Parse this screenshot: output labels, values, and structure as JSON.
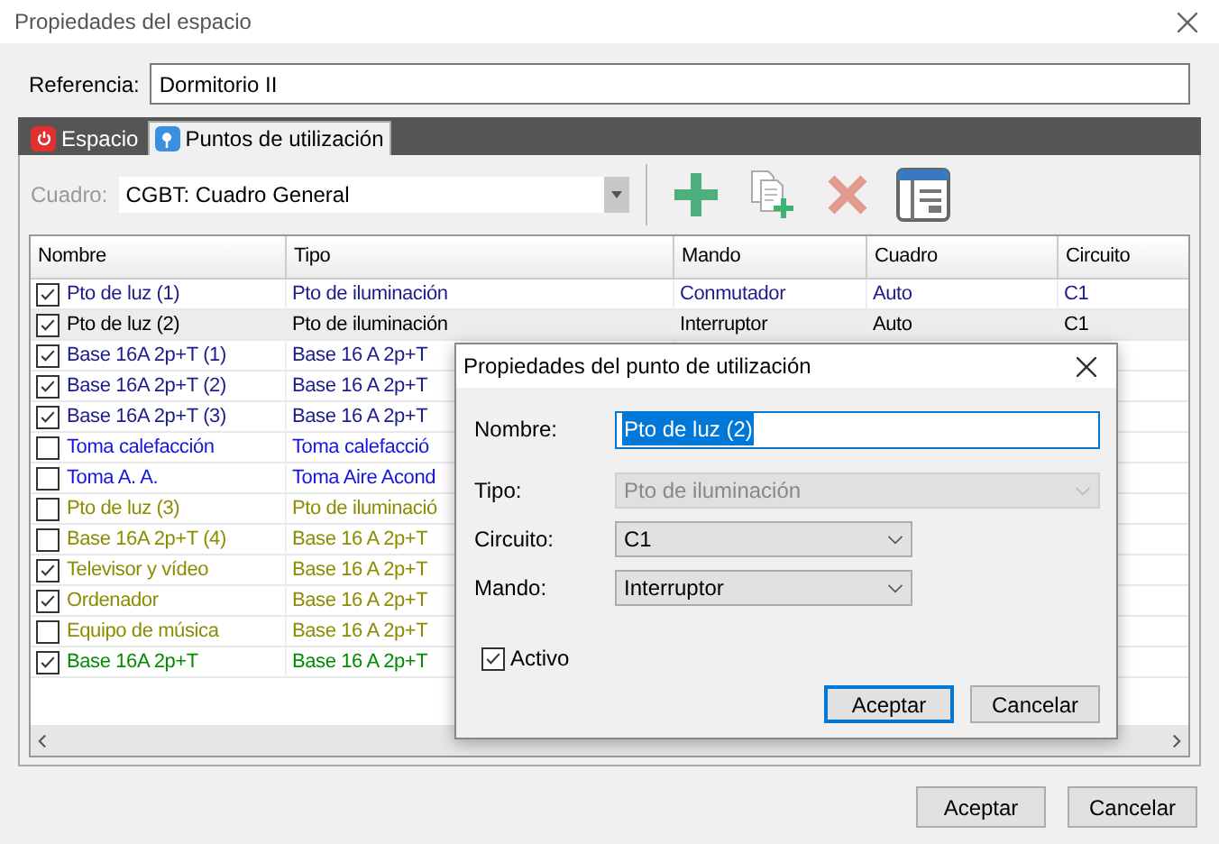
{
  "window": {
    "title": "Propiedades del espacio"
  },
  "referencia": {
    "label": "Referencia:",
    "value": "Dormitorio II"
  },
  "tabs": [
    {
      "label": "Espacio",
      "selected": false,
      "kind": "power"
    },
    {
      "label": "Puntos de utilización",
      "selected": true,
      "kind": "pin"
    }
  ],
  "cuadro": {
    "label": "Cuadro:",
    "value": "CGBT: Cuadro General"
  },
  "table": {
    "columns": [
      "Nombre",
      "Tipo",
      "Mando",
      "Cuadro",
      "Circuito"
    ],
    "rows": [
      {
        "checked": true,
        "selected": false,
        "color": "#1c1c8c",
        "cells": [
          "Pto de luz (1)",
          "Pto de iluminación",
          "Conmutador",
          "Auto",
          "C1"
        ]
      },
      {
        "checked": true,
        "selected": true,
        "color": "#000000",
        "cells": [
          "Pto de luz (2)",
          "Pto de iluminación",
          "Interruptor",
          "Auto",
          "C1"
        ]
      },
      {
        "checked": true,
        "selected": false,
        "color": "#1c1c8c",
        "cells": [
          "Base 16A 2p+T (1)",
          "Base 16 A 2p+T"
        ]
      },
      {
        "checked": true,
        "selected": false,
        "color": "#1c1c8c",
        "cells": [
          "Base 16A 2p+T (2)",
          "Base 16 A 2p+T"
        ]
      },
      {
        "checked": true,
        "selected": false,
        "color": "#1c1c8c",
        "cells": [
          "Base 16A 2p+T (3)",
          "Base 16 A 2p+T"
        ]
      },
      {
        "checked": false,
        "selected": false,
        "color": "#1414e6",
        "cells": [
          "Toma calefacción",
          "Toma calefacció"
        ]
      },
      {
        "checked": false,
        "selected": false,
        "color": "#1414e6",
        "cells": [
          "Toma A. A.",
          "Toma Aire Acond"
        ]
      },
      {
        "checked": false,
        "selected": false,
        "color": "#8c8c00",
        "cells": [
          "Pto de luz (3)",
          "Pto de iluminació"
        ]
      },
      {
        "checked": false,
        "selected": false,
        "color": "#8c8c00",
        "cells": [
          "Base 16A 2p+T (4)",
          "Base 16 A 2p+T"
        ]
      },
      {
        "checked": true,
        "selected": false,
        "color": "#8c8c00",
        "cells": [
          "Televisor y vídeo",
          "Base 16 A 2p+T"
        ]
      },
      {
        "checked": true,
        "selected": false,
        "color": "#8c8c00",
        "cells": [
          "Ordenador",
          "Base 16 A 2p+T"
        ]
      },
      {
        "checked": false,
        "selected": false,
        "color": "#8c8c00",
        "cells": [
          "Equipo de música",
          "Base 16 A 2p+T"
        ]
      },
      {
        "checked": true,
        "selected": false,
        "color": "#008c00",
        "cells": [
          "Base 16A 2p+T",
          "Base 16 A 2p+T"
        ]
      }
    ]
  },
  "buttons": [
    "Aceptar",
    "Cancelar"
  ],
  "dialog": {
    "title": "Propiedades del punto de utilización",
    "fields": [
      {
        "label": "Nombre:",
        "value": "Pto de luz (2)",
        "kind": "text",
        "disabled": false
      },
      {
        "label": "Tipo:",
        "value": "Pto de iluminación",
        "kind": "select",
        "disabled": true
      },
      {
        "label": "Circuito:",
        "value": "C1",
        "kind": "select",
        "disabled": false
      },
      {
        "label": "Mando:",
        "value": "Interruptor",
        "kind": "select",
        "disabled": false
      }
    ],
    "activo": {
      "label": "Activo",
      "checked": true
    },
    "buttons": [
      "Aceptar",
      "Cancelar"
    ]
  }
}
